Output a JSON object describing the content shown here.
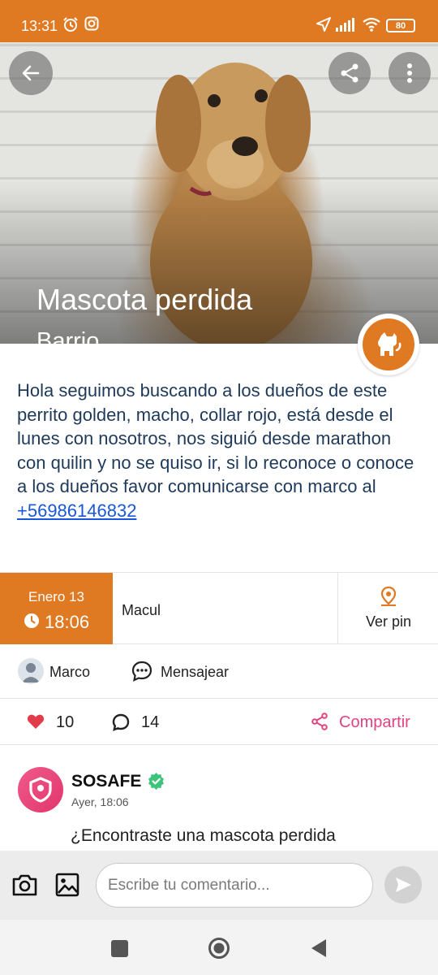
{
  "status_bar": {
    "time": "13:31",
    "battery": "80",
    "icons": [
      "alarm-icon",
      "instagram-icon",
      "location-arrow-icon",
      "signal-icon",
      "wifi-icon",
      "battery-icon"
    ]
  },
  "hero": {
    "title": "Mascota perdida",
    "subtitle": "Barrio",
    "image_count": 5,
    "active_image": 1,
    "category_icon": "dog-icon"
  },
  "post": {
    "description": "Hola seguimos buscando a los dueños de este perrito golden, macho, collar rojo, está desde el lunes con nosotros, nos siguió desde marathon con quilin y no se quiso ir, si lo reconoce o conoce a los dueños favor comunicarse con marco al ",
    "phone": "+56986146832"
  },
  "info": {
    "date": "Enero 13",
    "time": "18:06",
    "place": "Macul",
    "pin_label": "Ver pin"
  },
  "user": {
    "name": "Marco",
    "message_label": "Mensajear"
  },
  "stats": {
    "likes": "10",
    "comments": "14",
    "share_label": "Compartir"
  },
  "comment": {
    "author": "SOSAFE",
    "time": "Ayer, 18:06",
    "text": "¿Encontraste una mascota perdida"
  },
  "compose": {
    "placeholder": "Escribe tu comentario..."
  },
  "colors": {
    "brand_orange": "#e07a22",
    "share_pink": "#e0447f",
    "link_blue": "#1a57d8",
    "text_navy": "#1e3a5a"
  }
}
